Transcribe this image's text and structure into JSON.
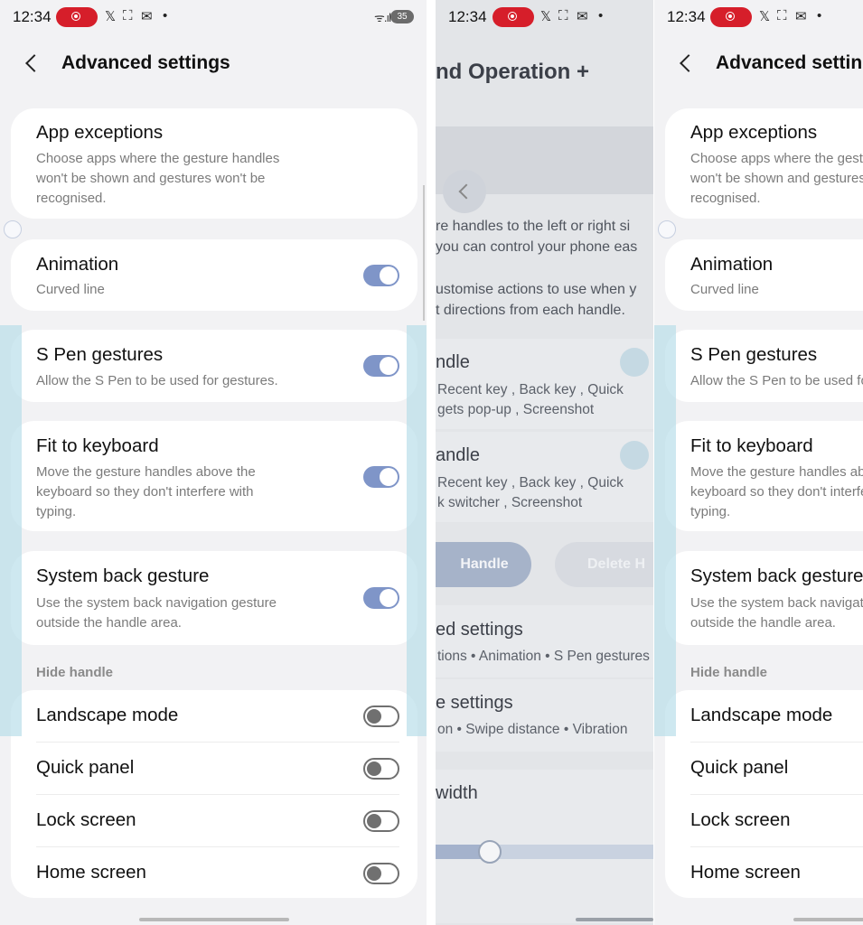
{
  "status": {
    "time": "12:34",
    "icons": [
      "recording-icon",
      "x-icon",
      "screenshot-icon",
      "mail-icon",
      "dot-icon",
      "wifi-icon",
      "signal-icon",
      "battery-icon"
    ],
    "battery": "35"
  },
  "header": {
    "title": "Advanced settings"
  },
  "settings": {
    "app_exceptions": {
      "title": "App exceptions",
      "desc": "Choose apps where the gesture handles\nwon't be shown and gestures won't be\nrecognised."
    },
    "animation": {
      "title": "Animation",
      "desc": "Curved line",
      "on": true
    },
    "spen": {
      "title": "S Pen gestures",
      "desc": "Allow the S Pen to be used for gestures.",
      "on": true
    },
    "fit_keyboard": {
      "title": "Fit to keyboard",
      "desc": "Move the gesture handles above the\nkeyboard so they don't interfere with\ntyping.",
      "on": true
    },
    "system_back": {
      "title": "System back gesture",
      "desc": "Use the system back navigation gesture\noutside the handle area.",
      "on": true
    }
  },
  "hide_handle": {
    "label": "Hide handle",
    "items": [
      {
        "label": "Landscape mode",
        "on": false
      },
      {
        "label": "Quick panel",
        "on": false
      },
      {
        "label": "Lock screen",
        "on": false
      },
      {
        "label": "Home screen",
        "on": false
      }
    ]
  },
  "middle": {
    "title": "nd Operation +",
    "intro_1": "re handles to the left or right si",
    "intro_2": "you can control your phone eas",
    "intro_3": "ustomise actions to use when y",
    "intro_4": "t directions from each handle.",
    "handle1_title": "ndle",
    "handle1_desc": "Recent key , Back key , Quick\ngets pop-up , Screenshot",
    "handle2_title": "andle",
    "handle2_desc": "Recent key , Back key , Quick\nk switcher , Screenshot",
    "add_button": "Handle",
    "delete_button": "Delete H",
    "adv_title": "ed settings",
    "adv_desc": "tions • Animation • S Pen gestures",
    "more_title": "e settings",
    "more_desc": "on • Swipe distance • Vibration",
    "width_label": "width",
    "width_value": 0.25
  }
}
